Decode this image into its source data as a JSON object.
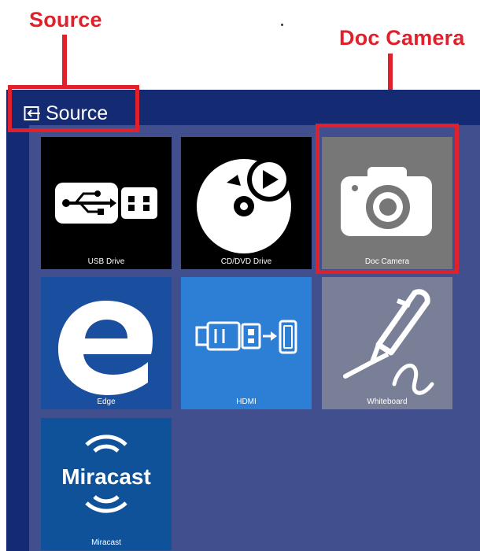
{
  "annotations": {
    "source_label": "Source",
    "doc_camera_label": "Doc Camera"
  },
  "header": {
    "title": "Source",
    "icon": "source-input-icon"
  },
  "tiles": [
    {
      "label": "USB Drive",
      "icon": "usb-icon",
      "color": "#000000"
    },
    {
      "label": "CD/DVD Drive",
      "icon": "cd-dvd-icon",
      "color": "#000000"
    },
    {
      "label": "Doc Camera",
      "icon": "camera-icon",
      "color": "#777777"
    },
    {
      "label": "Edge",
      "icon": "edge-icon",
      "color": "#1a4e9e"
    },
    {
      "label": "HDMI",
      "icon": "hdmi-icon",
      "color": "#2d7fd6"
    },
    {
      "label": "Whiteboard",
      "icon": "pen-icon",
      "color": "#7a7f98"
    },
    {
      "label": "Miracast",
      "icon": "miracast-icon",
      "color": "#0f5299",
      "logo_text": "Miracast"
    }
  ],
  "colors": {
    "panel": "#142a73",
    "grid": "#414f8e",
    "highlight": "#e0202a"
  }
}
